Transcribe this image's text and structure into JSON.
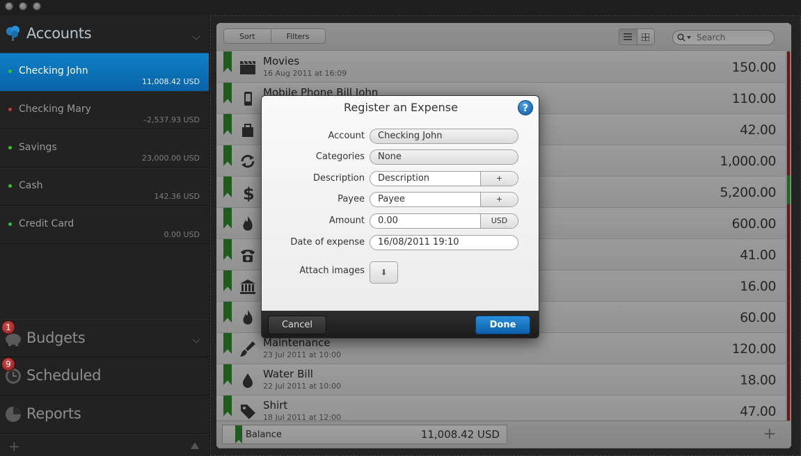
{
  "sidebar": {
    "accounts_title": "Accounts",
    "accounts": [
      {
        "name": "Checking John",
        "balance": "11,008.42 USD",
        "status_color": "#36c236",
        "selected": true
      },
      {
        "name": "Checking Mary",
        "balance": "–2,537.93 USD",
        "status_color": "#c23a3a",
        "selected": false
      },
      {
        "name": "Savings",
        "balance": "23,000.00 USD",
        "status_color": "#36c236",
        "selected": false
      },
      {
        "name": "Cash",
        "balance": "142.36 USD",
        "status_color": "#36c236",
        "selected": false
      },
      {
        "name": "Credit Card",
        "balance": "0.00 USD",
        "status_color": "#36c236",
        "selected": false
      }
    ],
    "budgets_title": "Budgets",
    "budgets_badge": "1",
    "scheduled_title": "Scheduled",
    "scheduled_badge": "9",
    "reports_title": "Reports"
  },
  "toolbar": {
    "sort_label": "Sort",
    "filters_label": "Filters",
    "search_placeholder": "Search"
  },
  "transactions": [
    {
      "title": "Movies",
      "date": "16 Aug 2011 at 16:09",
      "amount": "150.00",
      "icon": "clapperboard-icon"
    },
    {
      "title": "Mobile Phone Bill John",
      "date": "",
      "amount": "110.00",
      "icon": "mobile-phone-icon"
    },
    {
      "title": "",
      "date": "",
      "amount": "42.00",
      "icon": "shopping-bag-icon"
    },
    {
      "title": "",
      "date": "",
      "amount": "1,000.00",
      "icon": "transfer-icon"
    },
    {
      "title": "",
      "date": "",
      "amount": "5,200.00",
      "icon": "dollar-icon"
    },
    {
      "title": "",
      "date": "",
      "amount": "600.00",
      "icon": "flame-icon"
    },
    {
      "title": "",
      "date": "",
      "amount": "41.00",
      "icon": "telephone-icon"
    },
    {
      "title": "",
      "date": "",
      "amount": "16.00",
      "icon": "bank-icon"
    },
    {
      "title": "",
      "date": "",
      "amount": "60.00",
      "icon": "flame-icon"
    },
    {
      "title": "Maintenance",
      "date": "23 Jul 2011 at 10:00",
      "amount": "120.00",
      "icon": "brush-icon"
    },
    {
      "title": "Water Bill",
      "date": "22 Jul 2011 at 10:00",
      "amount": "18.00",
      "icon": "water-drop-icon"
    },
    {
      "title": "Shirt",
      "date": "18 Jul 2011 at 12:00",
      "amount": "47.00",
      "icon": "tag-icon"
    }
  ],
  "balance": {
    "label": "Balance",
    "value": "11,008.42 USD"
  },
  "dialog": {
    "title": "Register an Expense",
    "help_label": "?",
    "account_label": "Account",
    "account_value": "Checking John",
    "categories_label": "Categories",
    "categories_value": "None",
    "description_label": "Description",
    "description_placeholder": "Description",
    "payee_label": "Payee",
    "payee_placeholder": "Payee",
    "add_label": "+",
    "amount_label": "Amount",
    "amount_value": "0.00",
    "currency": "USD",
    "date_label": "Date of expense",
    "date_value": "16/08/2011 19:10",
    "attach_label": "Attach images",
    "cancel_label": "Cancel",
    "done_label": "Done"
  },
  "colors": {
    "accent_blue": "#0f7fc6",
    "flag_green": "#2f8a2f",
    "strip_red": "#b31a1a"
  }
}
